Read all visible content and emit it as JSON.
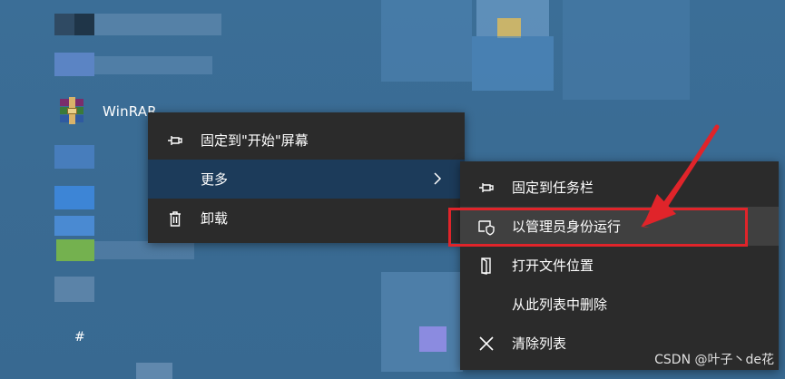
{
  "start_menu": {
    "app": {
      "label": "WinRAR",
      "icon": "winrar-icon"
    },
    "partial_text": "#"
  },
  "context_menu": {
    "items": [
      {
        "label": "固定到\"开始\"屏幕",
        "icon": "pin-icon"
      },
      {
        "label": "更多",
        "icon": "",
        "has_submenu": true
      },
      {
        "label": "卸载",
        "icon": "trash-icon"
      }
    ]
  },
  "submenu": {
    "items": [
      {
        "label": "固定到任务栏",
        "icon": "pin-icon"
      },
      {
        "label": "以管理员身份运行",
        "icon": "shield-icon"
      },
      {
        "label": "打开文件位置",
        "icon": "file-location-icon"
      },
      {
        "label": "从此列表中删除",
        "icon": ""
      },
      {
        "label": "清除列表",
        "icon": "close-icon"
      }
    ]
  },
  "annotation": {
    "color": "#e0242a"
  },
  "watermark": "CSDN @叶子丶de花",
  "colors": {
    "menu_bg": "#2b2b2b",
    "selected_bg": "#1c3b5a",
    "desktop_bg": "#3a6f98"
  }
}
